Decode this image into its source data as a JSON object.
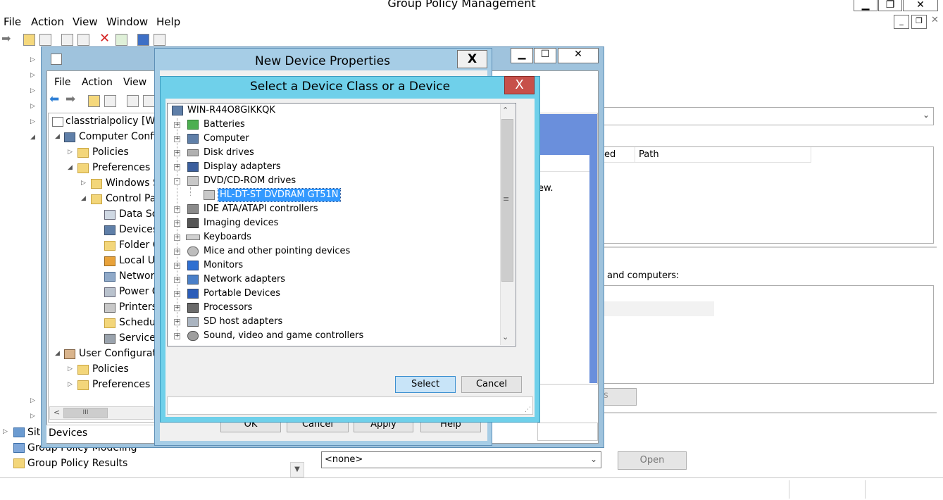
{
  "main_window": {
    "title": "Group Policy Management",
    "menu": [
      "File",
      "Action",
      "View",
      "Window",
      "Help"
    ],
    "tree_bottom": [
      {
        "label": "Site"
      },
      {
        "label": "Group Policy Modeling"
      },
      {
        "label": "Group Policy Results"
      }
    ],
    "right_pane": {
      "columns": [
        "ed",
        "Path"
      ],
      "text_new_view": "ew.",
      "text_and_computers": "and computers:",
      "partial_button": "s",
      "wmi_select_value": "<none>",
      "open_button": "Open"
    }
  },
  "gpme_window": {
    "menu": [
      "File",
      "Action",
      "View"
    ],
    "tree": [
      {
        "label": "classtrialpolicy [WI"
      },
      {
        "label": "Computer Confi"
      },
      {
        "label": "Policies"
      },
      {
        "label": "Preferences"
      },
      {
        "label": "Windows S"
      },
      {
        "label": "Control Pa"
      },
      {
        "label": "Data So"
      },
      {
        "label": "Devices"
      },
      {
        "label": "Folder C"
      },
      {
        "label": "Local U"
      },
      {
        "label": "Networ"
      },
      {
        "label": "Power C"
      },
      {
        "label": "Printers"
      },
      {
        "label": "Schedu"
      },
      {
        "label": "Services"
      },
      {
        "label": "User Configurati"
      },
      {
        "label": "Policies"
      },
      {
        "label": "Preferences"
      }
    ],
    "status": "Devices",
    "scroll_grip": "III"
  },
  "new_device_properties": {
    "title": "New Device Properties",
    "close": "X",
    "buttons": [
      "OK",
      "Cancel",
      "Apply",
      "Help"
    ]
  },
  "select_dialog": {
    "title": "Select a Device Class or a Device",
    "close": "X",
    "root": "WIN-R44O8GIKKQK",
    "items": [
      {
        "label": "Batteries",
        "expander": "+"
      },
      {
        "label": "Computer",
        "expander": "+"
      },
      {
        "label": "Disk drives",
        "expander": "+"
      },
      {
        "label": "Display adapters",
        "expander": "+"
      },
      {
        "label": "DVD/CD-ROM drives",
        "expander": "-"
      },
      {
        "label": "HL-DT-ST DVDRAM GT51N",
        "expander": "",
        "selected": true,
        "child": true
      },
      {
        "label": "IDE ATA/ATAPI controllers",
        "expander": "+"
      },
      {
        "label": "Imaging devices",
        "expander": "+"
      },
      {
        "label": "Keyboards",
        "expander": "+"
      },
      {
        "label": "Mice and other pointing devices",
        "expander": "+"
      },
      {
        "label": "Monitors",
        "expander": "+"
      },
      {
        "label": "Network adapters",
        "expander": "+"
      },
      {
        "label": "Portable Devices",
        "expander": "+"
      },
      {
        "label": "Processors",
        "expander": "+"
      },
      {
        "label": "SD host adapters",
        "expander": "+"
      },
      {
        "label": "Sound, video and game controllers",
        "expander": "+"
      }
    ],
    "select_button": "Select",
    "cancel_button": "Cancel"
  },
  "colors": {
    "selection": "#3399ff",
    "dialog_frame": "#6fd0ea",
    "close_red": "#c7504a"
  }
}
